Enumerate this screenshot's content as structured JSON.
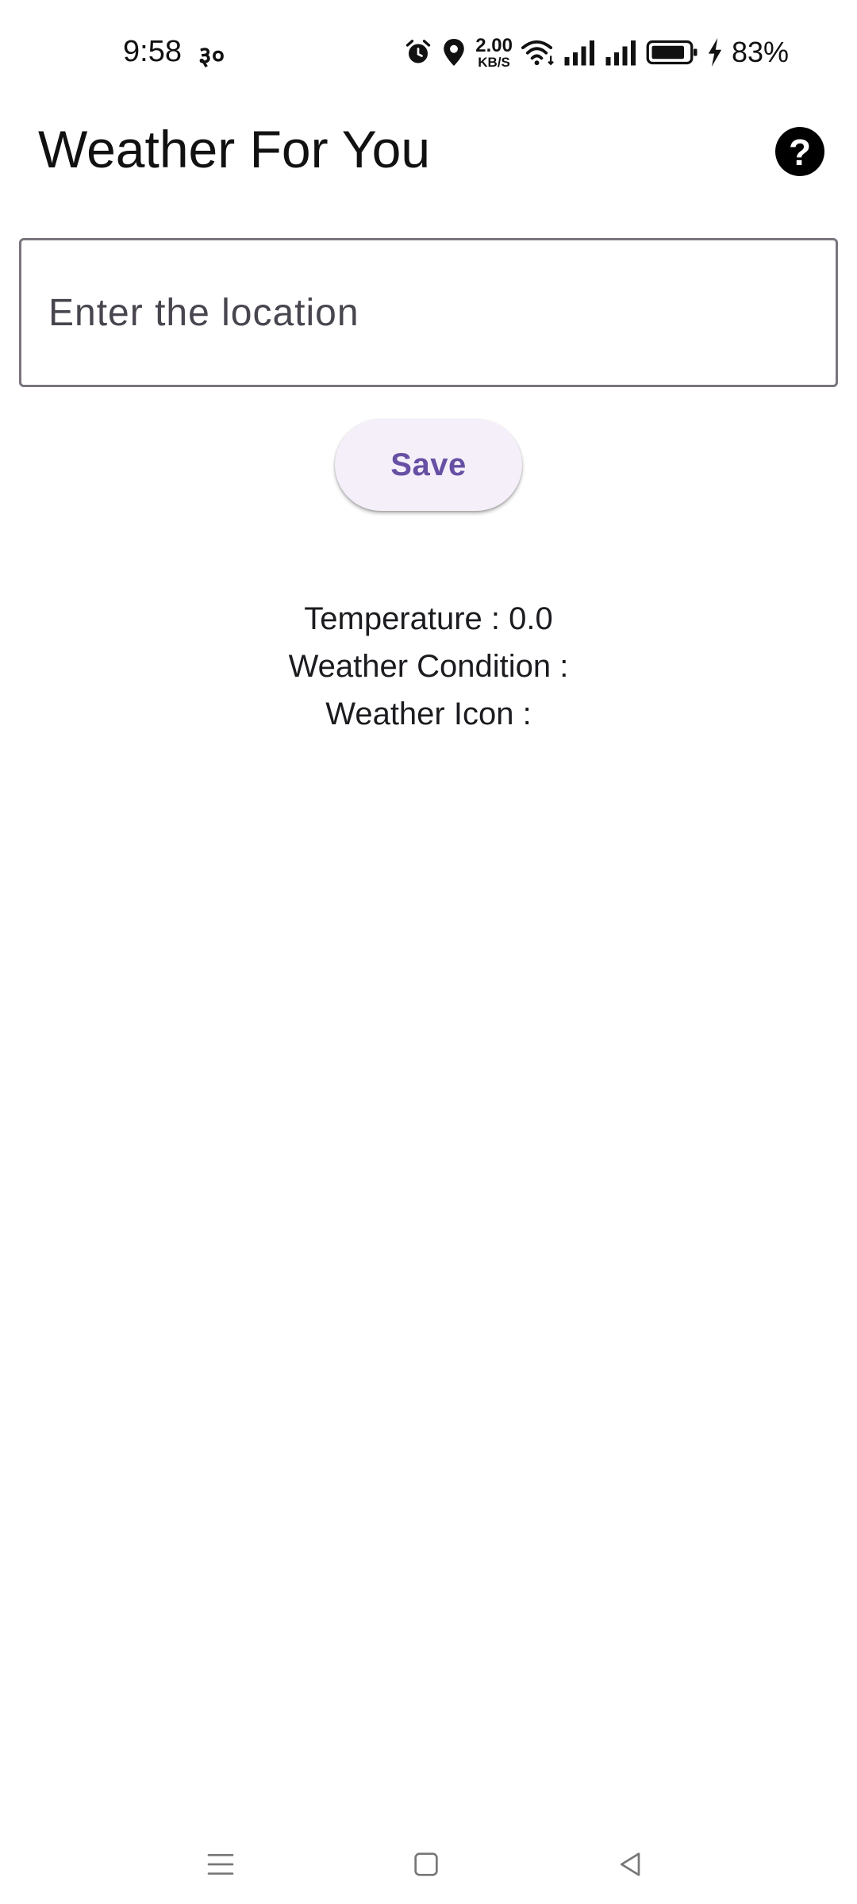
{
  "status_bar": {
    "time": "9:58",
    "extra_indicator": "३०",
    "net_speed_value": "2.00",
    "net_speed_unit": "KB/S",
    "battery_percent": "83%",
    "icons": [
      "alarm-icon",
      "location-icon",
      "wifi-icon",
      "signal-icon",
      "signal-icon",
      "battery-icon",
      "charging-icon"
    ]
  },
  "app_bar": {
    "title": "Weather For You",
    "help_icon": "help-icon"
  },
  "location_input": {
    "placeholder": "Enter the location",
    "value": ""
  },
  "save_button": {
    "label": "Save"
  },
  "results": {
    "temperature_label": "Temperature : 0.0",
    "condition_label": "Weather Condition :",
    "icon_label": "Weather Icon :"
  },
  "nav_bar": {
    "icons": [
      "menu-icon",
      "home-icon",
      "back-icon"
    ]
  },
  "colors": {
    "accent": "#6750a4",
    "button_bg": "#f5effa",
    "outline": "#79747e"
  }
}
